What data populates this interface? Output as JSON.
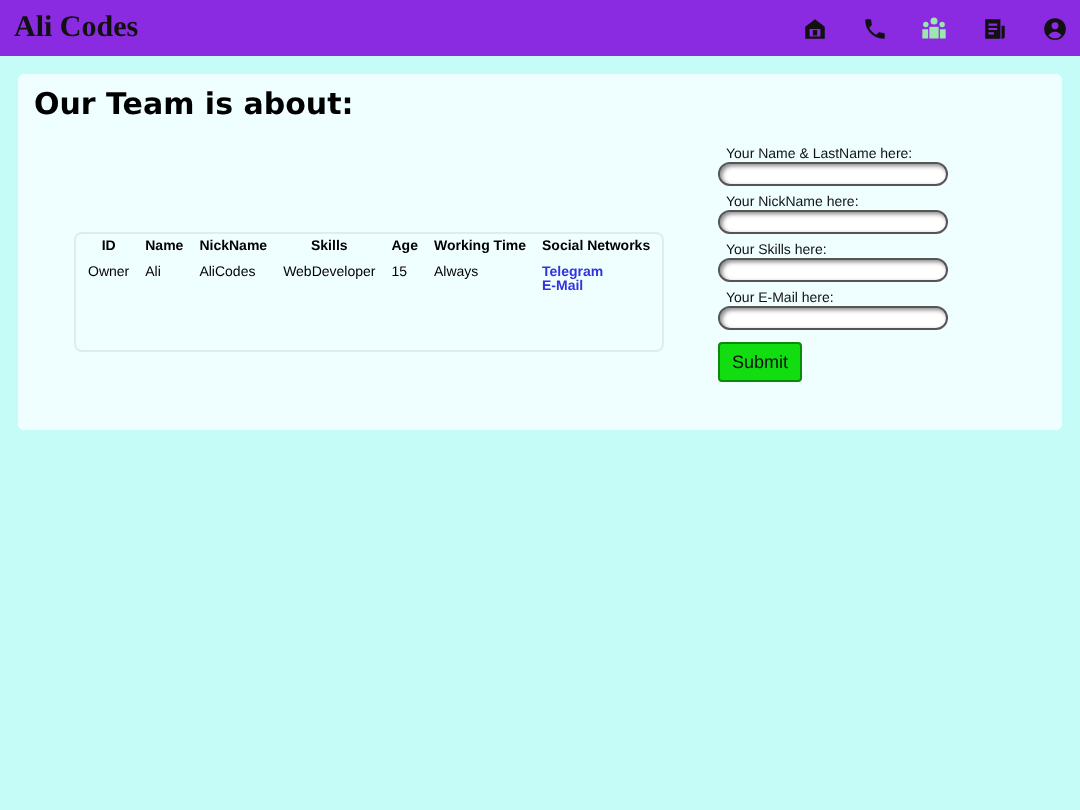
{
  "header": {
    "title": "Ali Codes",
    "nav": [
      {
        "kind": "home",
        "selected": false
      },
      {
        "kind": "phone",
        "selected": false
      },
      {
        "kind": "team",
        "selected": true
      },
      {
        "kind": "document",
        "selected": false
      },
      {
        "kind": "account",
        "selected": false
      }
    ]
  },
  "section": {
    "heading": "Our Team is about:"
  },
  "table": {
    "columns": [
      "ID",
      "Name",
      "NickName",
      "Skills",
      "Age",
      "Working Time",
      "Social Networks"
    ],
    "rows": [
      {
        "cells": [
          "Owner",
          "Ali",
          "AliCodes",
          "WebDeveloper",
          "15",
          "Always"
        ],
        "links": [
          "Telegram",
          "E-Mail"
        ]
      }
    ]
  },
  "form": {
    "fields": [
      {
        "label": "Your Name & LastName here:"
      },
      {
        "label": "Your NickName here:"
      },
      {
        "label": "Your Skills here:"
      },
      {
        "label": "Your E-Mail here:"
      }
    ],
    "submit": "Submit"
  }
}
